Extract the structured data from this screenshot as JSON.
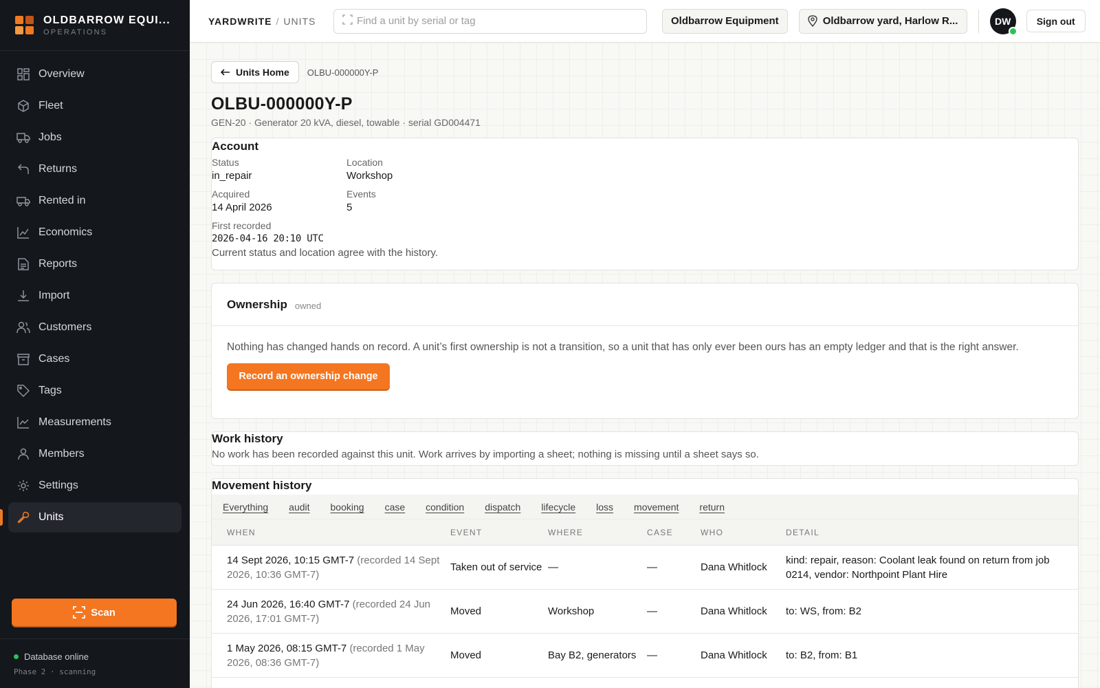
{
  "brand": {
    "name": "OLDBARROW EQUI...",
    "sub": "OPERATIONS"
  },
  "nav": [
    {
      "label": "Overview",
      "icon": "grid-icon"
    },
    {
      "label": "Fleet",
      "icon": "cube-icon"
    },
    {
      "label": "Jobs",
      "icon": "truck-icon"
    },
    {
      "label": "Returns",
      "icon": "return-arrow-icon"
    },
    {
      "label": "Rented in",
      "icon": "van-icon"
    },
    {
      "label": "Economics",
      "icon": "chart-icon"
    },
    {
      "label": "Reports",
      "icon": "document-icon"
    },
    {
      "label": "Import",
      "icon": "download-icon"
    },
    {
      "label": "Customers",
      "icon": "users-icon"
    },
    {
      "label": "Cases",
      "icon": "archive-icon"
    },
    {
      "label": "Tags",
      "icon": "tag-icon"
    },
    {
      "label": "Measurements",
      "icon": "line-chart-icon"
    },
    {
      "label": "Members",
      "icon": "user-icon"
    },
    {
      "label": "Settings",
      "icon": "gear-icon"
    },
    {
      "label": "Units",
      "icon": "wrench-icon",
      "active": true
    }
  ],
  "scan_label": "Scan",
  "footer": {
    "db_status": "Database online",
    "phase": "Phase 2 · scanning"
  },
  "topbar": {
    "app": "YARDWRITE",
    "section": "UNITS",
    "search_placeholder": "Find a unit by serial or tag",
    "org": "Oldbarrow Equipment",
    "location": "Oldbarrow yard, Harlow R...",
    "avatar_initials": "DW",
    "signout": "Sign out"
  },
  "page": {
    "back_label": "Units Home",
    "back_serial": "OLBU-000000Y-P",
    "title": "OLBU-000000Y-P",
    "subtitle": "GEN-20 · Generator 20 kVA, diesel, towable · serial GD004471"
  },
  "account": {
    "heading": "Account",
    "status_label": "Status",
    "status": "in_repair",
    "location_label": "Location",
    "location": "Workshop",
    "acquired_label": "Acquired",
    "acquired": "14 April 2026",
    "events_label": "Events",
    "events": "5",
    "first_recorded_label": "First recorded",
    "first_recorded": "2026-04-16 20:10 UTC",
    "agree_note": "Current status and location agree with the history."
  },
  "ownership": {
    "heading": "Ownership",
    "tag": "owned",
    "body": "Nothing has changed hands on record. A unit’s first ownership is not a transition, so a unit that has only ever been ours has an empty ledger and that is the right answer.",
    "button": "Record an ownership change"
  },
  "work": {
    "heading": "Work history",
    "body": "No work has been recorded against this unit. Work arrives by importing a sheet; nothing is missing until a sheet says so."
  },
  "movement": {
    "heading": "Movement history",
    "filters": [
      "Everything",
      "audit",
      "booking",
      "case",
      "condition",
      "dispatch",
      "lifecycle",
      "loss",
      "movement",
      "return"
    ],
    "columns": [
      "WHEN",
      "EVENT",
      "WHERE",
      "CASE",
      "WHO",
      "DETAIL"
    ],
    "rows": [
      {
        "when": "14 Sept 2026, 10:15 GMT-7",
        "recorded": "(recorded 14 Sept 2026, 10:36 GMT-7)",
        "event": "Taken out of service",
        "where": "—",
        "case": "—",
        "who": "Dana Whitlock",
        "detail": "kind: repair, reason: Coolant leak found on return from job 0214, vendor: Northpoint Plant Hire"
      },
      {
        "when": "24 Jun 2026, 16:40 GMT-7",
        "recorded": "(recorded 24 Jun 2026, 17:01 GMT-7)",
        "event": "Moved",
        "where": "Workshop",
        "case": "—",
        "who": "Dana Whitlock",
        "detail": "to: WS, from: B2"
      },
      {
        "when": "1 May 2026, 08:15 GMT-7",
        "recorded": "(recorded 1 May 2026, 08:36 GMT-7)",
        "event": "Moved",
        "where": "Bay B2, generators",
        "case": "—",
        "who": "Dana Whitlock",
        "detail": "to: B2, from: B1"
      }
    ]
  },
  "colors": {
    "accent": "#f47620",
    "sidebar": "#14171b",
    "online": "#2bc15a"
  }
}
